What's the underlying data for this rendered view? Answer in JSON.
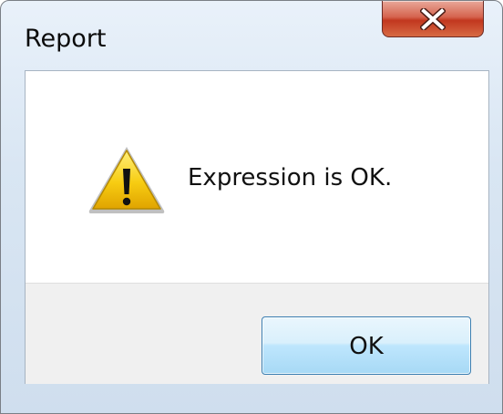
{
  "window": {
    "title": "Report",
    "close_icon": "close-icon"
  },
  "message": {
    "icon": "warning-icon",
    "text": "Expression is OK."
  },
  "buttons": {
    "ok_label": "OK"
  },
  "colors": {
    "close_button": "#c2371f",
    "warning_yellow": "#f5c400",
    "ok_button_border": "#3c7fb1"
  }
}
